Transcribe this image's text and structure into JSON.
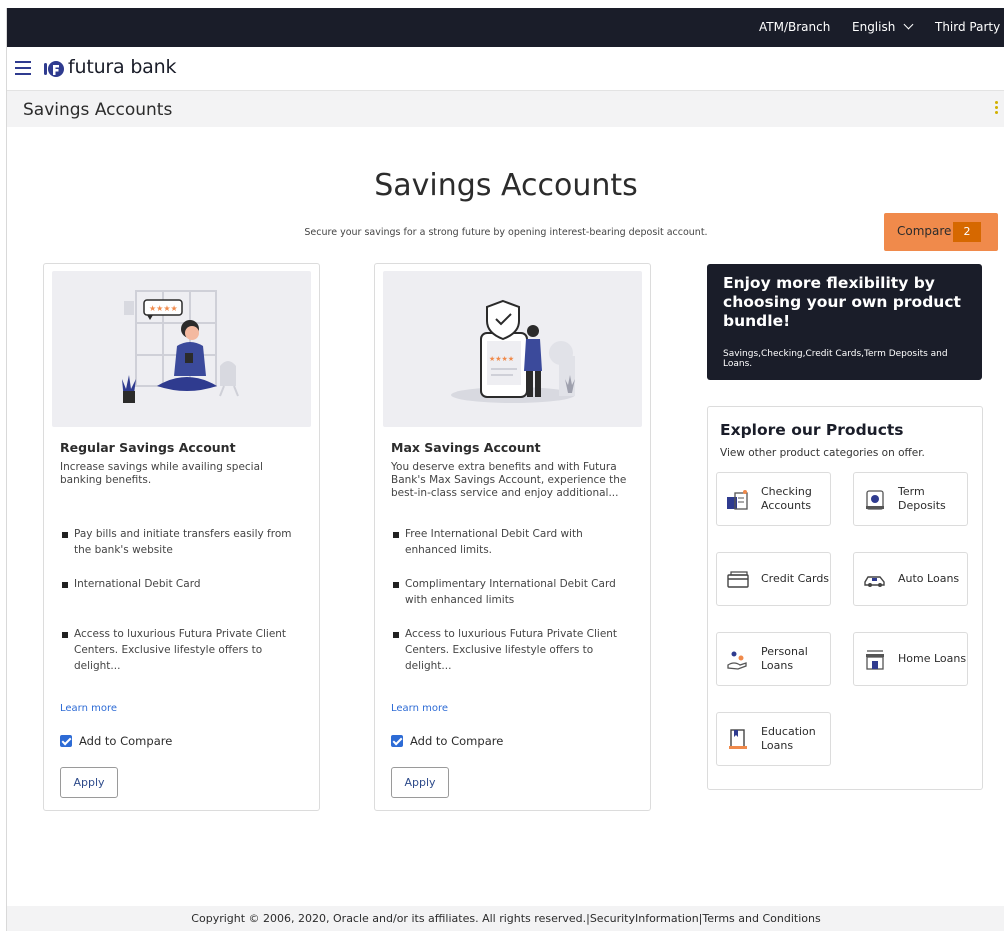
{
  "topbar": {
    "atm_branch": "ATM/Branch",
    "language": "English",
    "third_party": "Third Party"
  },
  "brand": {
    "name": "futura bank"
  },
  "page": {
    "title": "Savings Accounts"
  },
  "hero": {
    "title": "Savings Accounts",
    "subtitle": "Secure your savings for a strong future by opening interest-bearing deposit account."
  },
  "compare": {
    "label": "Compare",
    "count": "2"
  },
  "products": [
    {
      "name": "Regular Savings Account",
      "description": "Increase savings while availing special banking benefits.",
      "features": [
        "Pay bills and initiate transfers easily from the bank's website",
        "International Debit Card",
        "Access to luxurious Futura Private Client Centers. Exclusive lifestyle offers to delight..."
      ],
      "learn_more": "Learn more",
      "add_to_compare": "Add to Compare",
      "apply": "Apply"
    },
    {
      "name": "Max Savings Account",
      "description": "You deserve extra benefits and with Futura Bank's Max Savings Account, experience the best-in-class service and enjoy additional...",
      "features": [
        "Free International Debit Card with enhanced limits.",
        "Complimentary International Debit Card with enhanced limits",
        "Access to luxurious Futura Private Client Centers. Exclusive lifestyle offers to delight..."
      ],
      "learn_more": "Learn more",
      "add_to_compare": "Add to Compare",
      "apply": "Apply"
    }
  ],
  "promo": {
    "heading": "Enjoy more flexibility by choosing your own product bundle!",
    "text": "Savings,Checking,Credit Cards,Term Deposits and Loans."
  },
  "explore": {
    "heading": "Explore our Products",
    "subheading": "View other product categories on offer.",
    "categories": [
      {
        "label": "Checking Accounts",
        "icon": "checking-icon"
      },
      {
        "label": "Term Deposits",
        "icon": "term-deposit-icon"
      },
      {
        "label": "Credit Cards",
        "icon": "credit-card-icon"
      },
      {
        "label": "Auto Loans",
        "icon": "car-icon"
      },
      {
        "label": "Personal Loans",
        "icon": "personal-loan-icon"
      },
      {
        "label": "Home Loans",
        "icon": "home-icon"
      },
      {
        "label": "Education Loans",
        "icon": "education-icon"
      }
    ]
  },
  "footer": {
    "copyright": "Copyright © 2006, 2020, Oracle and/or its affiliates. All rights reserved.|SecurityInformation|Terms and Conditions"
  },
  "colors": {
    "dark": "#1a1d29",
    "accent_orange": "#f08a4b",
    "badge_orange": "#d66800",
    "link_blue": "#2d6bd5"
  }
}
